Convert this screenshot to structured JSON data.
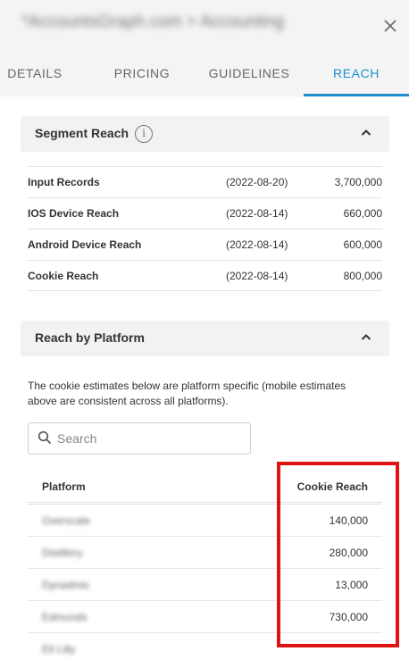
{
  "header": {
    "title": "*AccountsGraph.com > Accounting"
  },
  "tabs": [
    {
      "label": "DETAILS",
      "active": false
    },
    {
      "label": "PRICING",
      "active": false
    },
    {
      "label": "GUIDELINES",
      "active": false
    },
    {
      "label": "REACH",
      "active": true
    }
  ],
  "segment_reach": {
    "title": "Segment Reach",
    "rows": [
      {
        "label": "Input Records",
        "date": "(2022-08-20)",
        "value": "3,700,000"
      },
      {
        "label": "IOS Device Reach",
        "date": "(2022-08-14)",
        "value": "660,000"
      },
      {
        "label": "Android Device Reach",
        "date": "(2022-08-14)",
        "value": "600,000"
      },
      {
        "label": "Cookie Reach",
        "date": "(2022-08-14)",
        "value": "800,000"
      }
    ]
  },
  "reach_by_platform": {
    "title": "Reach by Platform",
    "description": "The cookie estimates below are platform specific (mobile estimates above are consistent across all platforms).",
    "search_placeholder": "Search",
    "columns": [
      "Platform",
      "Cookie Reach"
    ],
    "rows": [
      {
        "platform": "Overscale",
        "reach": "140,000"
      },
      {
        "platform": "Distillery",
        "reach": "280,000"
      },
      {
        "platform": "Dynadmic",
        "reach": "13,000"
      },
      {
        "platform": "Edmunds",
        "reach": "730,000"
      },
      {
        "platform": "Eli Lilly",
        "reach": ""
      }
    ]
  },
  "colors": {
    "accent": "#1e8ecf",
    "highlight": "#e01212"
  }
}
